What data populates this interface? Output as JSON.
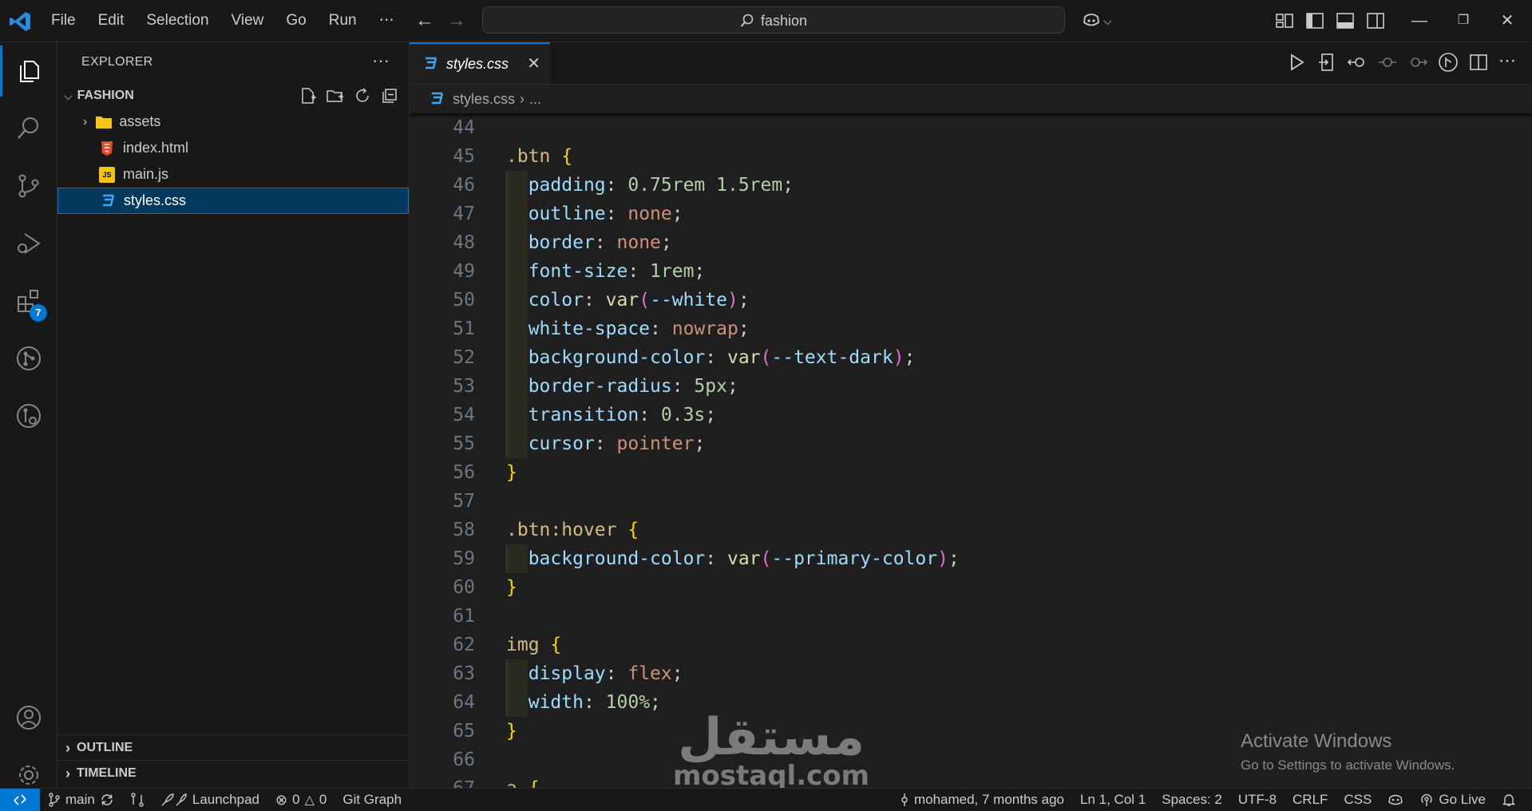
{
  "menu": [
    "File",
    "Edit",
    "Selection",
    "View",
    "Go",
    "Run",
    "⋯"
  ],
  "search": {
    "text": "fashion"
  },
  "explorer": {
    "title": "EXPLORER",
    "more": "···",
    "folder": "FASHION",
    "items": [
      {
        "label": "assets",
        "kind": "folder"
      },
      {
        "label": "index.html",
        "kind": "html"
      },
      {
        "label": "main.js",
        "kind": "js"
      },
      {
        "label": "styles.css",
        "kind": "css"
      }
    ],
    "outline": "OUTLINE",
    "timeline": "TIMELINE"
  },
  "activity": {
    "extensions_badge": "7"
  },
  "tab": {
    "label": "styles.css"
  },
  "breadcrumb": {
    "file": "styles.css",
    "sep": "›",
    "rest": "..."
  },
  "code": {
    "line_numbers": [
      "44",
      "45",
      "46",
      "47",
      "48",
      "49",
      "50",
      "51",
      "52",
      "53",
      "54",
      "55",
      "56",
      "57",
      "58",
      "59",
      "60",
      "61",
      "62",
      "63",
      "64",
      "65",
      "66",
      "67"
    ]
  },
  "watermark": {
    "activate_title": "Activate Windows",
    "activate_sub": "Go to Settings to activate Windows.",
    "mostaql_ar": "مستقل",
    "mostaql_en": "mostaql.com"
  },
  "status": {
    "branch": "main",
    "launchpad": "Launchpad",
    "errors": "0",
    "warnings": "0",
    "git_graph": "Git Graph",
    "blame": "mohamed, 7 months ago",
    "position": "Ln 1, Col 1",
    "spaces": "Spaces: 2",
    "encoding": "UTF-8",
    "eol": "CRLF",
    "language": "CSS",
    "golive": "Go Live"
  },
  "colors": {
    "accent": "#0078d4",
    "css_icon": "#42a5f5",
    "html_icon": "#e44d26",
    "js_icon": "#f1c40f",
    "folder_icon": "#f5c518"
  }
}
